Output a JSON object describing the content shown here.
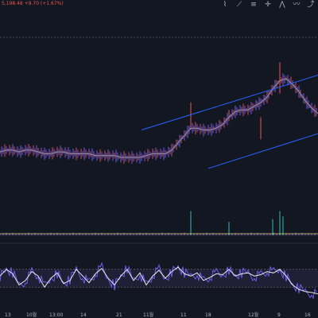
{
  "header": {
    "symbol": "",
    "price_line": "5,198.48  +9.70 (+1.67%)"
  },
  "toolbar": {
    "icons": [
      "brush-icon",
      "ruler-icon",
      "fib-icon",
      "crosshair-icon",
      "pattern-icon",
      "zigzag-icon",
      "trend-icon"
    ]
  },
  "x_axis": {
    "labels": [
      "13",
      "10월",
      "13:00",
      "14",
      "21",
      "11월",
      "11",
      "18",
      "12월",
      "9",
      "16"
    ]
  },
  "colors": {
    "background": "#131722",
    "price_line": "#9598a1",
    "candles": "#7b61ff",
    "candle_up": "#ef5350",
    "channel": "#2962ff",
    "volume_ma": "#f7d774",
    "rsi_band": "#7e57c2",
    "rsi_line": "#ffffff",
    "dashed": "#5d606b"
  },
  "chart_data": {
    "type": "line",
    "title": "",
    "xlabel": "",
    "ylabel": "",
    "price_series": {
      "name": "",
      "x": [
        0,
        8,
        16,
        24,
        32,
        40,
        48,
        56,
        64,
        72,
        80,
        88,
        96,
        104,
        112,
        120,
        128,
        136,
        144,
        152,
        160,
        168,
        176,
        184,
        192,
        200,
        208,
        216,
        224,
        232,
        240,
        248,
        256,
        264,
        272,
        280,
        288,
        296,
        304,
        312,
        320,
        328,
        336,
        344,
        352,
        360,
        368,
        376,
        384,
        392,
        400
      ],
      "y": [
        0.43,
        0.44,
        0.44,
        0.43,
        0.44,
        0.44,
        0.43,
        0.42,
        0.42,
        0.43,
        0.43,
        0.42,
        0.42,
        0.42,
        0.42,
        0.41,
        0.41,
        0.41,
        0.41,
        0.4,
        0.4,
        0.4,
        0.4,
        0.41,
        0.42,
        0.42,
        0.42,
        0.44,
        0.48,
        0.52,
        0.56,
        0.56,
        0.55,
        0.55,
        0.56,
        0.58,
        0.62,
        0.65,
        0.66,
        0.66,
        0.68,
        0.7,
        0.73,
        0.78,
        0.82,
        0.83,
        0.8,
        0.76,
        0.71,
        0.67,
        0.64
      ]
    },
    "channel_upper": {
      "x": [
        178,
        400
      ],
      "y": [
        0.2,
        0.72
      ]
    },
    "channel_lower": {
      "x": [
        262,
        400
      ],
      "y": [
        0.12,
        0.45
      ]
    },
    "volume_spikes": {
      "x": [
        240,
        288,
        343,
        352,
        356
      ],
      "y": [
        0.9,
        0.5,
        0.6,
        0.9,
        0.7
      ]
    },
    "rsi": {
      "x": [
        0,
        8,
        16,
        24,
        32,
        40,
        48,
        56,
        64,
        72,
        80,
        88,
        96,
        104,
        112,
        120,
        128,
        136,
        144,
        152,
        160,
        168,
        176,
        184,
        192,
        200,
        208,
        216,
        224,
        232,
        240,
        248,
        256,
        264,
        272,
        280,
        288,
        296,
        304,
        312,
        320,
        328,
        336,
        344,
        352,
        360,
        368,
        376,
        384,
        392,
        400
      ],
      "y": [
        0.55,
        0.7,
        0.6,
        0.35,
        0.45,
        0.65,
        0.55,
        0.3,
        0.5,
        0.62,
        0.38,
        0.45,
        0.7,
        0.55,
        0.4,
        0.6,
        0.72,
        0.5,
        0.35,
        0.55,
        0.7,
        0.45,
        0.62,
        0.35,
        0.55,
        0.68,
        0.5,
        0.65,
        0.75,
        0.6,
        0.55,
        0.62,
        0.45,
        0.52,
        0.6,
        0.58,
        0.7,
        0.55,
        0.6,
        0.62,
        0.55,
        0.58,
        0.65,
        0.62,
        0.7,
        0.55,
        0.35,
        0.25,
        0.2,
        0.18,
        0.15
      ],
      "bands": [
        30,
        70
      ]
    }
  }
}
